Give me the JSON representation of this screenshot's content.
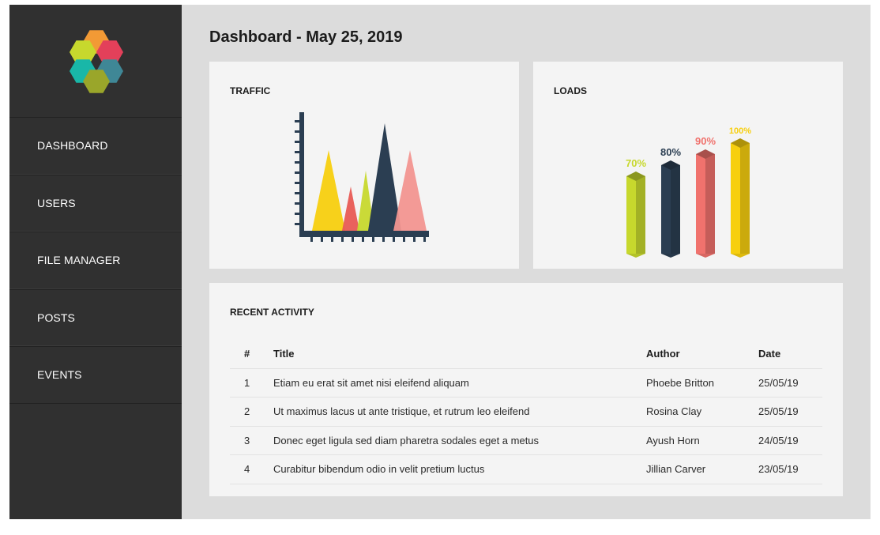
{
  "nav": {
    "items": [
      {
        "label": "DASHBOARD"
      },
      {
        "label": "USERS"
      },
      {
        "label": "FILE MANAGER"
      },
      {
        "label": "POSTS"
      },
      {
        "label": "EVENTS"
      }
    ]
  },
  "header": {
    "title": "Dashboard - May 25, 2019"
  },
  "traffic": {
    "title": "TRAFFIC",
    "colors": [
      "#f7cf0f",
      "#e85a54",
      "#c7d82d",
      "#2b3e52",
      "#f29590"
    ]
  },
  "loads": {
    "title": "LOADS",
    "bars": [
      {
        "label": "70%",
        "value": 70,
        "color": "#c7d82d"
      },
      {
        "label": "80%",
        "value": 80,
        "color": "#2b3e52"
      },
      {
        "label": "90%",
        "value": 90,
        "color": "#f0726d"
      },
      {
        "label": "100%",
        "value": 100,
        "color": "#f7cf0f"
      }
    ]
  },
  "activity": {
    "title": "RECENT ACTIVITY",
    "columns": [
      "#",
      "Title",
      "Author",
      "Date"
    ],
    "rows": [
      [
        "1",
        "Etiam eu erat sit amet nisi eleifend aliquam",
        "Phoebe Britton",
        "25/05/19"
      ],
      [
        "2",
        "Ut maximus lacus ut ante tristique, et rutrum leo eleifend",
        "Rosina Clay",
        "25/05/19"
      ],
      [
        "3",
        "Donec eget ligula sed diam pharetra sodales eget a metus",
        "Ayush Horn",
        "24/05/19"
      ],
      [
        "4",
        "Curabitur bibendum odio in velit pretium luctus",
        "Jillian Carver",
        "23/05/19"
      ]
    ]
  },
  "logo": {
    "colors": [
      "#f29a35",
      "#c7d82d",
      "#e3405a",
      "#19b7a8",
      "#3f8796",
      "#9aa62a"
    ]
  }
}
